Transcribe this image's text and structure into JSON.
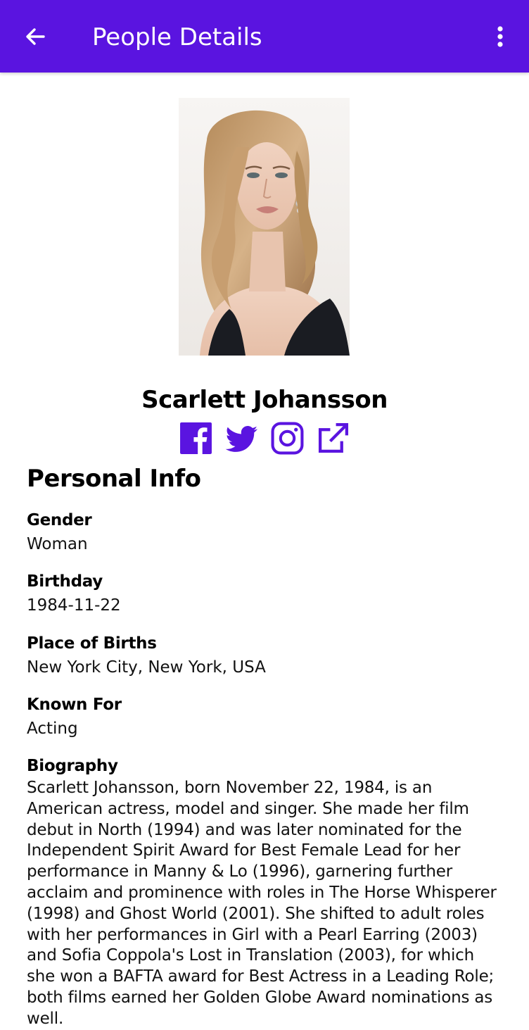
{
  "app_bar": {
    "title": "People Details",
    "back_icon": "arrow-left-icon",
    "menu_icon": "more-vertical-icon",
    "color": "#5a14e0"
  },
  "person": {
    "name": "Scarlett Johansson",
    "photo": "portrait-photo"
  },
  "social_links": [
    {
      "icon": "facebook-icon"
    },
    {
      "icon": "twitter-icon"
    },
    {
      "icon": "instagram-icon"
    },
    {
      "icon": "external-link-icon"
    }
  ],
  "accent_color": "#5a14e0",
  "personal_info": {
    "title": "Personal Info",
    "gender": {
      "label": "Gender",
      "value": "Woman"
    },
    "birthday": {
      "label": "Birthday",
      "value": "1984-11-22"
    },
    "place_of_birth": {
      "label": "Place of Births",
      "value": "New York City, New York, USA"
    },
    "known_for": {
      "label": "Known For",
      "value": "Acting"
    },
    "biography": {
      "label": "Biography",
      "value": "Scarlett Johansson, born November 22, 1984, is an American actress, model and singer. She made her film debut in North (1994) and was later nominated for the Independent Spirit Award for Best Female Lead for her performance in Manny & Lo (1996), garnering further acclaim and prominence with roles in The Horse Whisperer (1998) and Ghost World (2001). She shifted to adult roles with her performances in Girl with a Pearl Earring (2003) and Sofia Coppola's Lost in Translation (2003), for which she won a BAFTA award for Best Actress in a Leading Role; both films earned her Golden Globe Award nominations as well."
    }
  }
}
